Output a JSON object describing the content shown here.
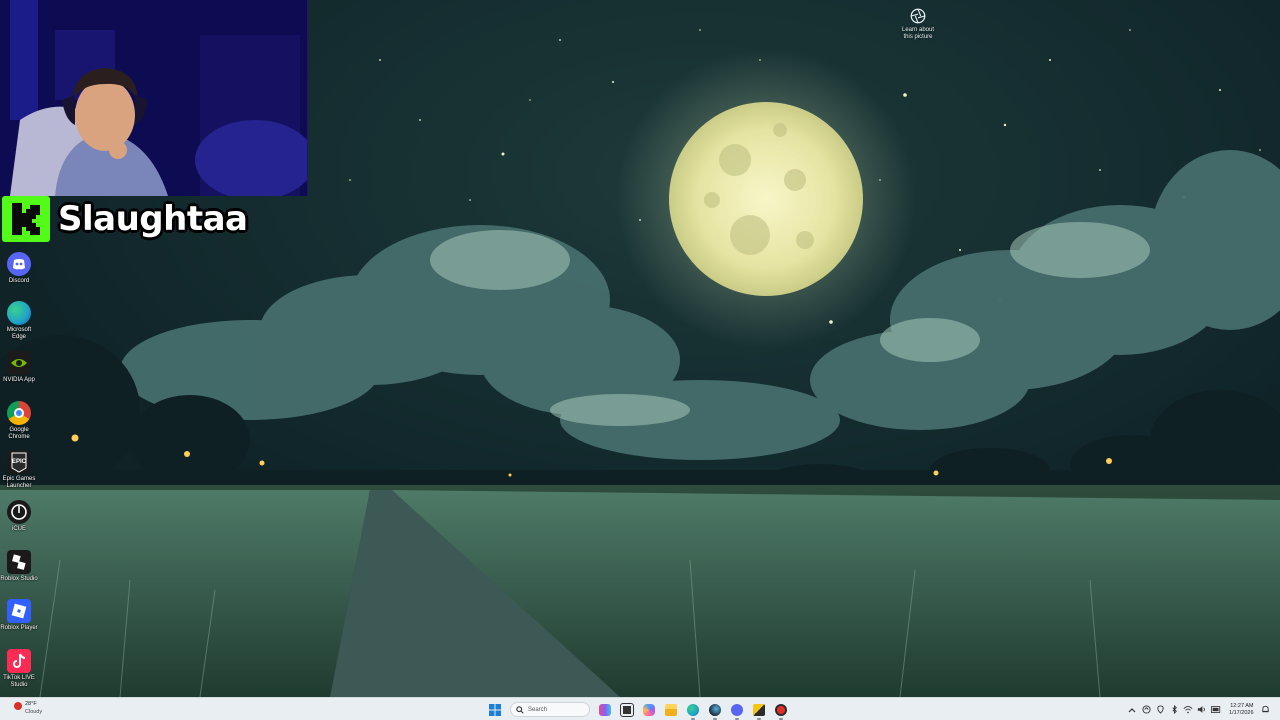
{
  "overlay": {
    "streamer_name": "Slaughtaa",
    "kick_logo_letter": "K",
    "kick_color": "#53fc18",
    "webcam_bg_color": "#0d0b52"
  },
  "wallpaper": {
    "learn_icon": "camera-aperture-icon",
    "learn_label_line1": "Learn about",
    "learn_label_line2": "this picture"
  },
  "desktop_icons": [
    {
      "name": "Discord",
      "icon": "discord-icon",
      "color": "#5865f2"
    },
    {
      "name": "Microsoft Edge",
      "icon": "edge-icon",
      "color": "#1fa2c9"
    },
    {
      "name": "NVIDIA App",
      "icon": "nvidia-icon",
      "color": "#76b900"
    },
    {
      "name": "Google Chrome",
      "icon": "chrome-icon",
      "color": "#db4437"
    },
    {
      "name": "Epic Games Launcher",
      "icon": "epic-games-icon",
      "color": "#1a1a1a"
    },
    {
      "name": "iCUE",
      "icon": "icue-icon",
      "color": "#1a1a1a"
    },
    {
      "name": "Roblox Studio",
      "icon": "roblox-studio-icon",
      "color": "#1a1a1a"
    },
    {
      "name": "Roblox Player",
      "icon": "roblox-player-icon",
      "color": "#335fff"
    },
    {
      "name": "TikTok LIVE Studio",
      "icon": "tiktok-icon",
      "color": "#fe2c55"
    }
  ],
  "taskbar": {
    "weather": {
      "temp": "28°F",
      "condition": "Cloudy",
      "icon": "weather-alert-icon"
    },
    "search_label": "Search",
    "pinned": [
      {
        "name": "Widgets",
        "icon": "widgets-icon"
      },
      {
        "name": "Task View",
        "icon": "task-view-icon"
      },
      {
        "name": "Copilot",
        "icon": "copilot-icon"
      },
      {
        "name": "File Explorer",
        "icon": "file-explorer-icon"
      },
      {
        "name": "Microsoft Edge",
        "icon": "edge-icon"
      },
      {
        "name": "Steam",
        "icon": "steam-icon"
      },
      {
        "name": "Discord",
        "icon": "discord-icon"
      },
      {
        "name": "Winamp",
        "icon": "winamp-icon"
      },
      {
        "name": "Recording App",
        "icon": "record-app-icon"
      }
    ],
    "clock": {
      "time": "12:27 AM",
      "date": "1/17/2026"
    }
  }
}
